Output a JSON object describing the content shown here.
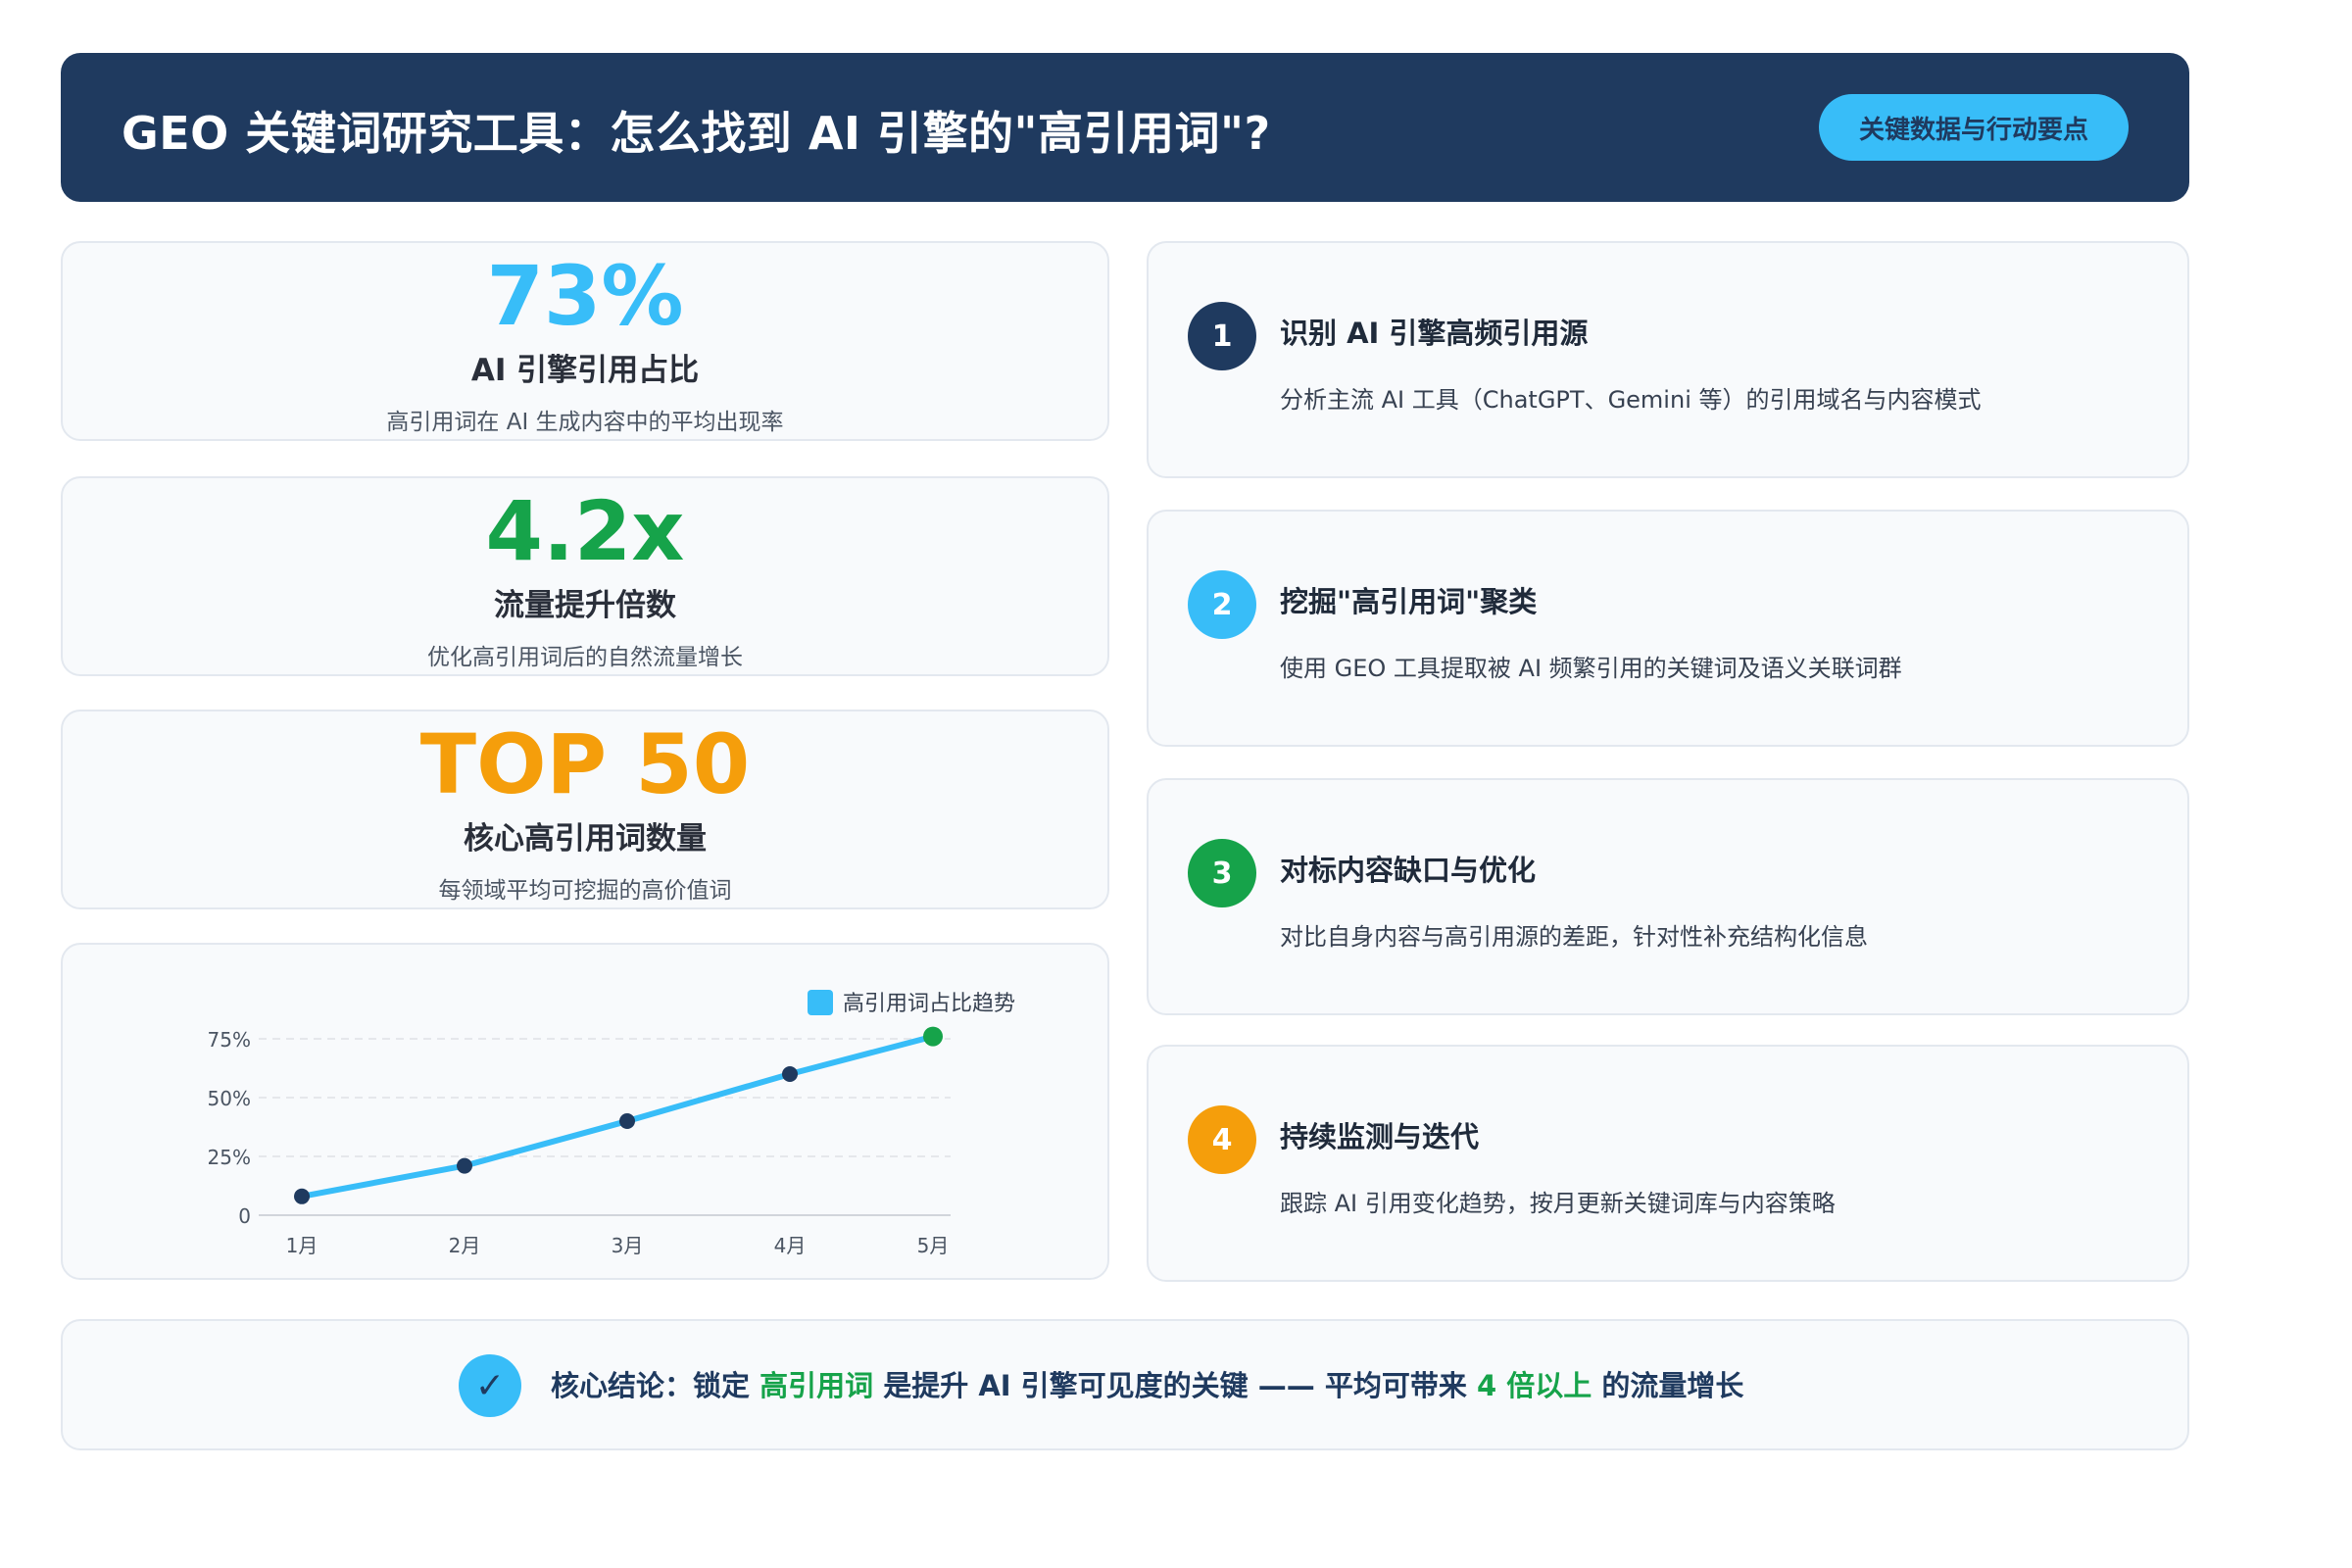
{
  "header": {
    "title": "GEO 关键词研究工具：怎么找到 AI 引擎的\"高引用词\"?",
    "badge": "关键数据与行动要点"
  },
  "colors": {
    "navy": "#1f3a5f",
    "blue": "#38bdf8",
    "green": "#16a34a",
    "orange": "#f59e0b"
  },
  "stats": [
    {
      "value": "73%",
      "label": "AI 引擎引用占比",
      "desc": "高引用词在 AI 生成内容中的平均出现率",
      "color": "#38bdf8"
    },
    {
      "value": "4.2x",
      "label": "流量提升倍数",
      "desc": "优化高引用词后的自然流量增长",
      "color": "#16a34a"
    },
    {
      "value": "TOP 50",
      "label": "核心高引用词数量",
      "desc": "每领域平均可挖掘的高价值词",
      "color": "#f59e0b"
    }
  ],
  "chart_data": {
    "type": "line",
    "categories": [
      "1月",
      "2月",
      "3月",
      "4月",
      "5月"
    ],
    "y_ticks": [
      "0",
      "25%",
      "50%",
      "75%"
    ],
    "ylim": [
      0,
      75
    ],
    "legend_position": "top-right",
    "grid": true,
    "series": [
      {
        "name": "高引用词占比趋势",
        "values": [
          8,
          21,
          40,
          60,
          76
        ],
        "color": "#38bdf8"
      }
    ]
  },
  "steps": [
    {
      "num": "1",
      "title": "识别 AI 引擎高频引用源",
      "desc": "分析主流 AI 工具（ChatGPT、Gemini 等）的引用域名与内容模式",
      "color": "#1f3a5f"
    },
    {
      "num": "2",
      "title": "挖掘\"高引用词\"聚类",
      "desc": "使用 GEO 工具提取被 AI 频繁引用的关键词及语义关联词群",
      "color": "#38bdf8"
    },
    {
      "num": "3",
      "title": "对标内容缺口与优化",
      "desc": "对比自身内容与高引用源的差距，针对性补充结构化信息",
      "color": "#16a34a"
    },
    {
      "num": "4",
      "title": "持续监测与迭代",
      "desc": "跟踪 AI 引用变化趋势，按月更新关键词库与内容策略",
      "color": "#f59e0b"
    }
  ],
  "conclusion": {
    "icon": "check-icon",
    "icon_glyph": "✓",
    "part1": "核心结论：锁定 ",
    "highlight1": "高引用词",
    "part2": " 是提升 AI 引擎可见度的关键 —— 平均可带来 ",
    "highlight2": "4 倍以上",
    "part3": " 的流量增长"
  }
}
